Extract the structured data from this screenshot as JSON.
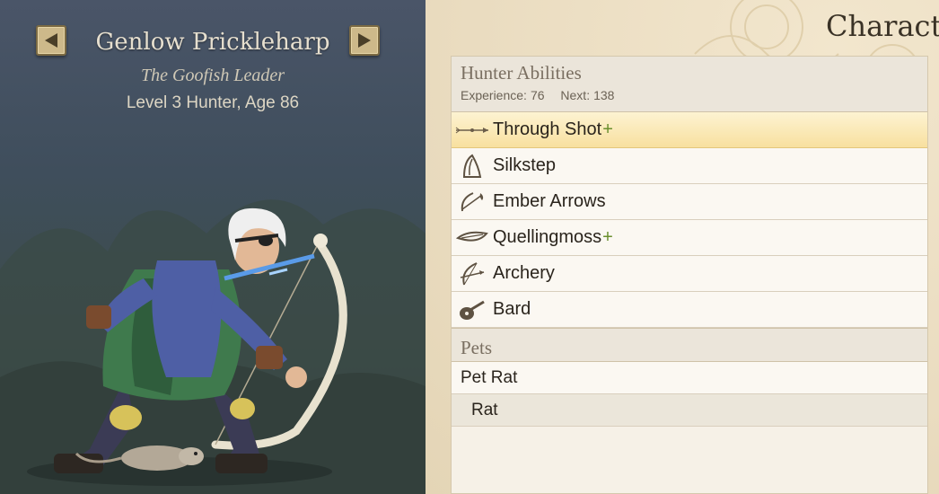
{
  "character": {
    "name": "Genlow Prickleharp",
    "title": "The Goofish Leader",
    "level_line": "Level 3 Hunter, Age 86"
  },
  "nav": {
    "prev_icon": "arrow-left-icon",
    "next_icon": "arrow-right-icon"
  },
  "panel": {
    "title": "Characte"
  },
  "abilities": {
    "header": "Hunter Abilities",
    "experience_label": "Experience:",
    "experience_value": "76",
    "next_label": "Next:",
    "next_value": "138",
    "items": [
      {
        "label": "Through Shot",
        "plus": "+",
        "icon": "arrow-shot-icon",
        "selected": true
      },
      {
        "label": "Silkstep",
        "plus": "",
        "icon": "cloak-icon",
        "selected": false
      },
      {
        "label": "Ember Arrows",
        "plus": "",
        "icon": "fire-bow-icon",
        "selected": false
      },
      {
        "label": "Quellingmoss",
        "plus": "+",
        "icon": "leaf-icon",
        "selected": false
      },
      {
        "label": "Archery",
        "plus": "",
        "icon": "bow-icon",
        "selected": false
      },
      {
        "label": "Bard",
        "plus": "",
        "icon": "lute-icon",
        "selected": false
      }
    ]
  },
  "pets": {
    "header": "Pets",
    "items": [
      {
        "label": "Pet Rat"
      },
      {
        "label": "Rat"
      }
    ]
  },
  "colors": {
    "selected_row": "#f8e09f",
    "plus_green": "#6a8f2e",
    "parchment": "#eadcc0",
    "portrait_bg": "#3f4e5c"
  }
}
